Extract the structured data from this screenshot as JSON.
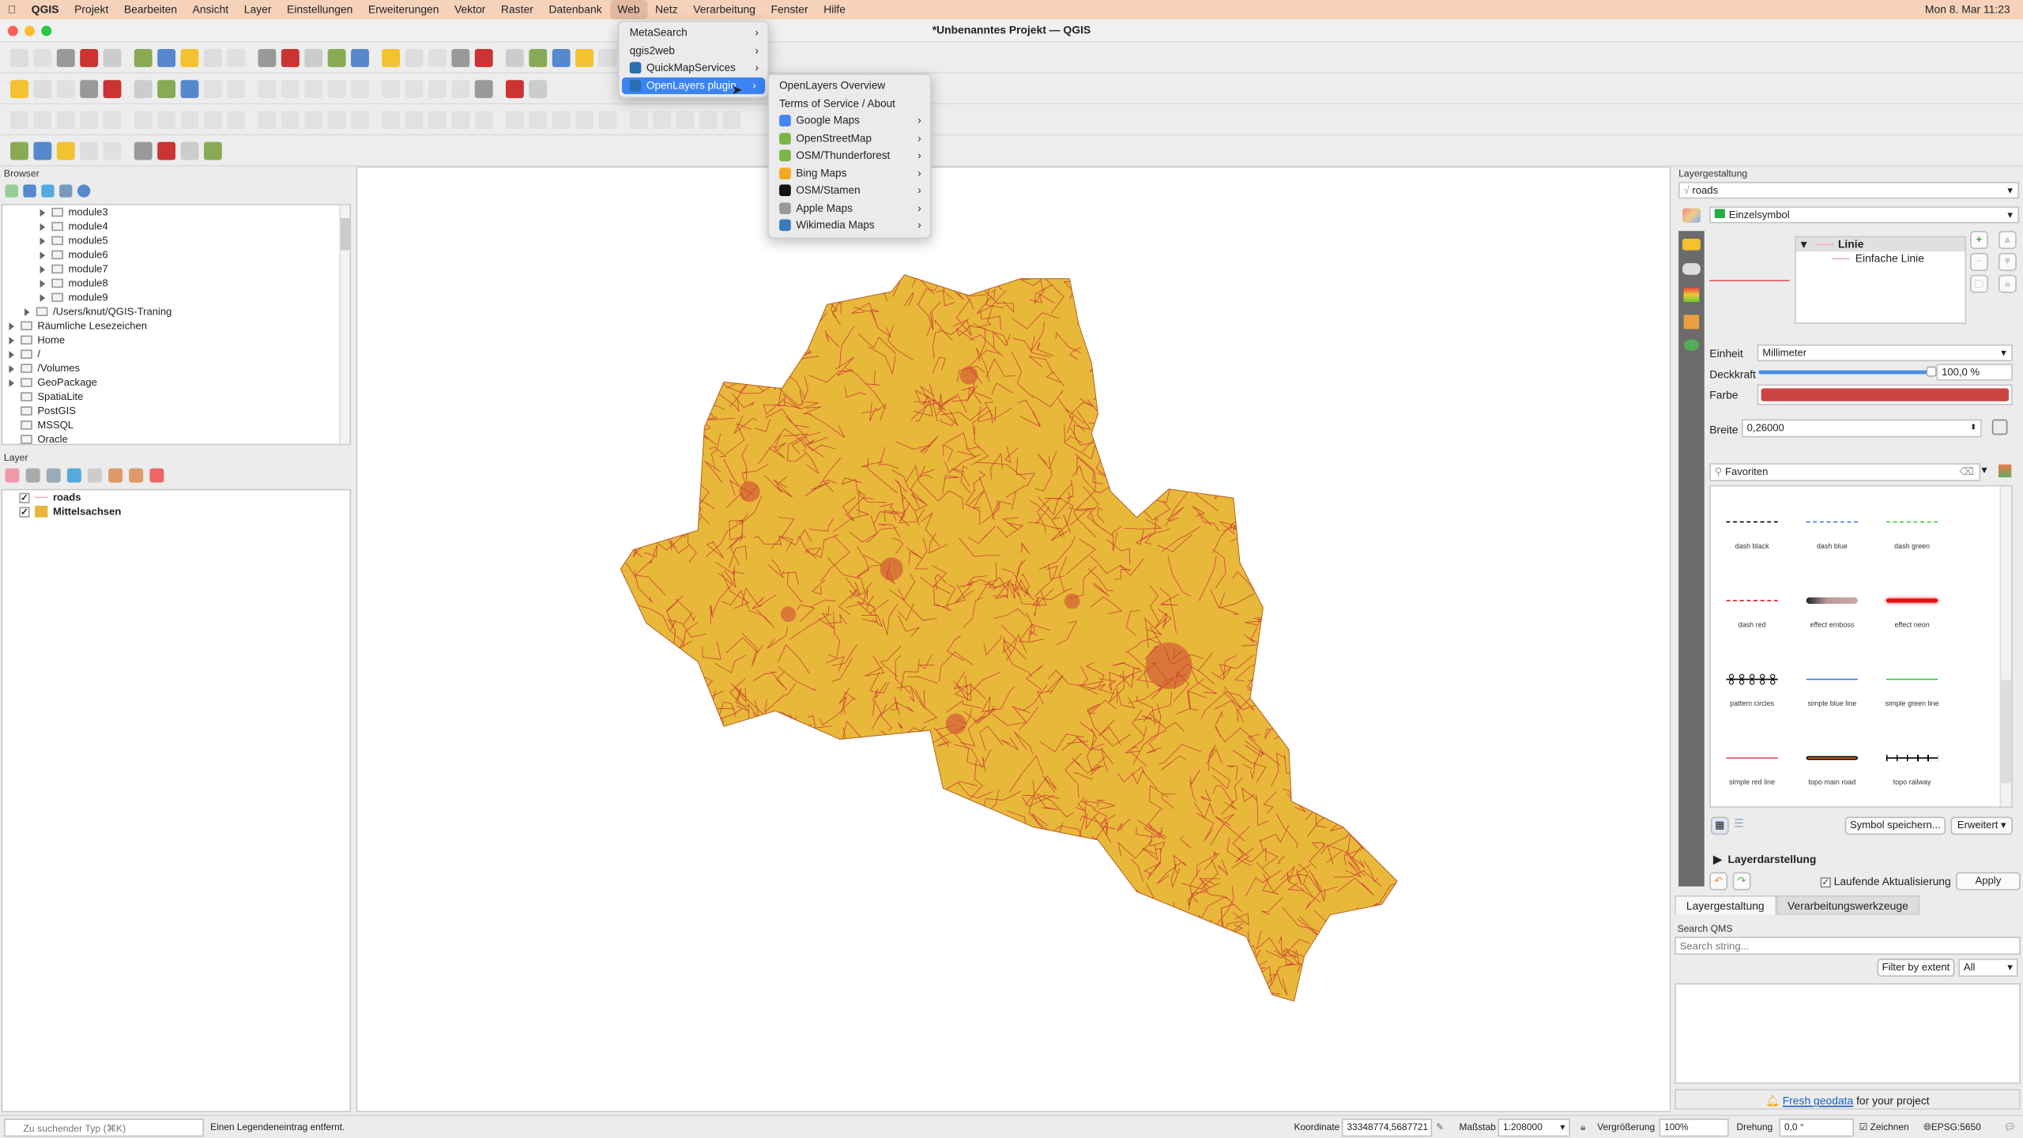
{
  "menubar": {
    "apple": "",
    "app": "QGIS",
    "items": [
      "Projekt",
      "Bearbeiten",
      "Ansicht",
      "Layer",
      "Einstellungen",
      "Erweiterungen",
      "Vektor",
      "Raster",
      "Datenbank",
      "Web",
      "Netz",
      "Verarbeitung",
      "Fenster",
      "Hilfe"
    ],
    "active": "Web",
    "clock": "Mon 8. Mar  11:23"
  },
  "window": {
    "title": "*Unbenanntes Projekt — QGIS"
  },
  "web_menu": {
    "items": [
      {
        "label": "MetaSearch",
        "submenu": true
      },
      {
        "label": "qgis2web",
        "submenu": true
      },
      {
        "label": "QuickMapServices",
        "submenu": true,
        "icon": "globe-icon"
      },
      {
        "label": "OpenLayers plugin",
        "submenu": true,
        "icon": "openlayers-icon",
        "highlighted": true
      }
    ]
  },
  "openlayers_menu": {
    "items": [
      {
        "label": "OpenLayers Overview"
      },
      {
        "label": "Terms of Service / About"
      },
      {
        "label": "Google Maps",
        "icon": "google-icon",
        "color": "#4285f4"
      },
      {
        "label": "OpenStreetMap",
        "icon": "osm-icon",
        "color": "#7ab648"
      },
      {
        "label": "OSM/Thunderforest",
        "icon": "osm-icon",
        "color": "#7ab648"
      },
      {
        "label": "Bing Maps",
        "icon": "bing-icon",
        "color": "#f5a623"
      },
      {
        "label": "OSM/Stamen",
        "icon": "stamen-icon",
        "color": "#111111"
      },
      {
        "label": "Apple Maps",
        "icon": "apple-icon",
        "color": "#999999"
      },
      {
        "label": "Wikimedia Maps",
        "icon": "wikimedia-icon",
        "color": "#3a7bbf"
      }
    ]
  },
  "browser": {
    "title": "Browser",
    "items": [
      {
        "label": "module3",
        "level": 2,
        "expand": true
      },
      {
        "label": "module4",
        "level": 2,
        "expand": true
      },
      {
        "label": "module5",
        "level": 2,
        "expand": true
      },
      {
        "label": "module6",
        "level": 2,
        "expand": true
      },
      {
        "label": "module7",
        "level": 2,
        "expand": true
      },
      {
        "label": "module8",
        "level": 2,
        "expand": true
      },
      {
        "label": "module9",
        "level": 2,
        "expand": true
      },
      {
        "label": "/Users/knut/QGIS-Traning",
        "level": 1,
        "expand": true
      },
      {
        "label": "Räumliche Lesezeichen",
        "level": 0,
        "expand": true
      },
      {
        "label": "Home",
        "level": 0,
        "expand": true
      },
      {
        "label": "/",
        "level": 0,
        "expand": true
      },
      {
        "label": "/Volumes",
        "level": 0,
        "expand": true
      },
      {
        "label": "GeoPackage",
        "level": 0,
        "expand": true
      },
      {
        "label": "SpatiaLite",
        "level": 0
      },
      {
        "label": "PostGIS",
        "level": 0
      },
      {
        "label": "MSSQL",
        "level": 0
      },
      {
        "label": "Oracle",
        "level": 0
      }
    ]
  },
  "layers": {
    "title": "Layer",
    "items": [
      {
        "label": "roads",
        "checked": true,
        "swatch": "line",
        "color": "#e8b4b4"
      },
      {
        "label": "Mittelsachsen",
        "checked": true,
        "swatch": "fill",
        "color": "#e8b83a"
      }
    ]
  },
  "map": {
    "fill": "#e8b83a",
    "roads": "#cc4433"
  },
  "style_panel": {
    "title": "Layergestaltung",
    "layer": "roads",
    "renderer": "Einzelsymbol",
    "tree": {
      "root": "Linie",
      "child": "Einfache Linie"
    },
    "unit_label": "Einheit",
    "unit": "Millimeter",
    "opacity_label": "Deckkraft",
    "opacity": "100,0 %",
    "opacity_value": 100,
    "color_label": "Farbe",
    "color": "#cc4444",
    "width_label": "Breite",
    "width": "0,26000",
    "search": "Favoriten",
    "symbols": [
      {
        "name": "dash  black",
        "style": "dash",
        "color": "#000000"
      },
      {
        "name": "dash blue",
        "style": "dash",
        "color": "#3a7be0"
      },
      {
        "name": "dash green",
        "style": "dash",
        "color": "#33cc33"
      },
      {
        "name": "dash red",
        "style": "dash",
        "color": "#e02020"
      },
      {
        "name": "effect emboss",
        "style": "emboss",
        "color": "#8a5a5a"
      },
      {
        "name": "effect neon",
        "style": "neon",
        "color": "#dd1111"
      },
      {
        "name": "pattern circles",
        "style": "circles",
        "color": "#000000"
      },
      {
        "name": "simple blue line",
        "style": "solid",
        "color": "#3a7be0"
      },
      {
        "name": "simple green line",
        "style": "solid",
        "color": "#33cc33"
      },
      {
        "name": "simple red line",
        "style": "solid",
        "color": "#e05060"
      },
      {
        "name": "topo main road",
        "style": "road",
        "color": "#f07010"
      },
      {
        "name": "topo railway",
        "style": "rail",
        "color": "#000000"
      }
    ],
    "save_symbol": "Symbol speichern...",
    "advanced": "Erweitert",
    "layer_rendering": "Layerdarstellung",
    "live_update": "Laufende Aktualisierung",
    "apply": "Apply",
    "tabs": [
      "Layergestaltung",
      "Verarbeitungswerkzeuge"
    ]
  },
  "qms": {
    "title": "Search QMS",
    "placeholder": "Search string...",
    "filter": "Filter by extent",
    "filter_select": "All",
    "fresh_link": "Fresh geodata",
    "fresh_text": " for your project"
  },
  "status": {
    "search_placeholder": "Zu suchender Typ (⌘K)",
    "message": "Einen Legendeneintrag entfernt.",
    "coord_label": "Koordinate",
    "coord": "33348774,5687721",
    "scale_label": "Maßstab",
    "scale": "1:208000",
    "mag_label": "Vergrößerung",
    "mag": "100%",
    "rot_label": "Drehung",
    "rot": "0,0 °",
    "render_label": "Zeichnen",
    "crs": "EPSG:5650"
  }
}
